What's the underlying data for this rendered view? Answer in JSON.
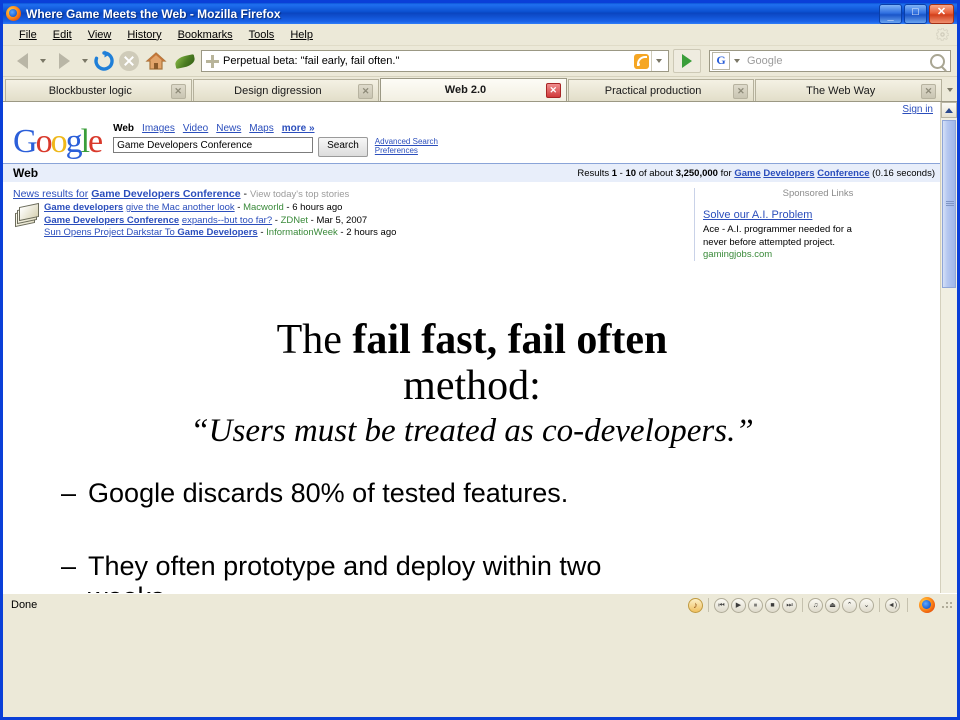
{
  "window": {
    "title": "Where Game Meets the Web - Mozilla Firefox",
    "app_icon": "firefox-icon",
    "minimize_label": "_",
    "maximize_label": "□",
    "close_label": "✕"
  },
  "menu": {
    "items": [
      "File",
      "Edit",
      "View",
      "History",
      "Bookmarks",
      "Tools",
      "Help"
    ],
    "gear_icon": "gear-icon"
  },
  "toolbar": {
    "back_icon": "back-arrow-icon",
    "forward_icon": "forward-arrow-icon",
    "reload_icon": "reload-icon",
    "stop_icon": "stop-icon",
    "home_icon": "home-icon",
    "leaf_icon": "leaf-icon",
    "url_value": "Perpetual beta: \"fail early, fail often.\"",
    "url_favicon": "page-favicon",
    "rss_icon": "rss-feed-icon",
    "go_icon": "go-arrow-icon",
    "search_engine_icon": "google-g-icon",
    "search_placeholder": "Google",
    "search_value": "",
    "search_magnifier_icon": "search-icon"
  },
  "tabs": {
    "items": [
      {
        "label": "Blockbuster logic",
        "active": false
      },
      {
        "label": "Design digression",
        "active": false
      },
      {
        "label": "Web 2.0",
        "active": true
      },
      {
        "label": "Practical production",
        "active": false
      },
      {
        "label": "The Web Way",
        "active": false
      }
    ],
    "close_label": "✕",
    "overflow_icon": "chevron-down-icon"
  },
  "google": {
    "signin_label": "Sign in",
    "logo_letters": [
      {
        "ch": "G",
        "color": "#2b5fd9"
      },
      {
        "ch": "o",
        "color": "#d9392b"
      },
      {
        "ch": "o",
        "color": "#efb81a"
      },
      {
        "ch": "g",
        "color": "#2b5fd9"
      },
      {
        "ch": "l",
        "color": "#3a9e3a"
      },
      {
        "ch": "e",
        "color": "#d9392b"
      }
    ],
    "nav_active": "Web",
    "nav_links": [
      "Images",
      "Video",
      "News",
      "Maps"
    ],
    "nav_more": "more »",
    "query": "Game Developers Conference",
    "search_button": "Search",
    "advanced_search": "Advanced Search",
    "preferences": "Preferences",
    "web_label": "Web",
    "results_prefix": "Results",
    "results_range_start": "1",
    "results_range_dash": "-",
    "results_range_end": "10",
    "results_about": "of about",
    "results_count": "3,250,000",
    "results_for": "for",
    "results_terms": [
      "Game",
      "Developers",
      "Conference"
    ],
    "results_time": "(0.16 seconds)",
    "news_heading_prefix": "News results for",
    "news_heading_query": "Game Developers Conference",
    "news_heading_dash": "-",
    "news_today_link": "View today's top stories",
    "news_icon": "news-stack-icon",
    "news_items": [
      {
        "title_plain": "Game developers",
        "title_link": "give the Mac another look",
        "source": "Macworld",
        "date": "6 hours ago",
        "bold_lead": true
      },
      {
        "title_plain": "Game Developers Conference",
        "title_link": "expands--but too far?",
        "source": "ZDNet",
        "date": "Mar 5, 2007",
        "bold_lead": true
      },
      {
        "title_plain": "Sun Opens Project Darkstar To ",
        "title_link": "Game Developers",
        "source": "InformationWeek",
        "date": "2 hours ago",
        "bold_lead": false
      }
    ],
    "sponsored_title": "Sponsored Links",
    "sponsored": {
      "title": "Solve our A.I. Problem",
      "line1": "Ace - A.I. programmer needed for a",
      "line2": "never before attempted project.",
      "url": "gamingjobs.com"
    },
    "scroll_up_icon": "scroll-up-arrow-icon"
  },
  "slide": {
    "title_part1": "The ",
    "title_bold": "fail fast, fail often",
    "title_part2": "method:",
    "quote": "“Users must be treated as co-developers.”",
    "bullets": [
      {
        "marker": "–",
        "text": "Google discards 80% of tested features."
      },
      {
        "marker": "–",
        "text": "They often prototype and deploy within two weeks."
      }
    ]
  },
  "statusbar": {
    "status": "Done",
    "media": {
      "collapse_icon": "collapse-left-icon",
      "note_icon": "music-note-icon",
      "prev_icon": "previous-track-icon",
      "play_icon": "play-icon",
      "pause_icon": "pause-icon",
      "stop_icon": "stop-icon",
      "next_icon": "next-track-icon",
      "eq_icon": "equalizer-note-icon",
      "open_icon": "eject-icon",
      "vol_up_icon": "volume-up-icon",
      "vol_down_icon": "volume-down-icon",
      "mute_icon": "speaker-icon",
      "more_icon": "overflow-arrow-icon",
      "tray_icon": "firefox-tray-icon",
      "grip_icon": "resize-grip-icon"
    }
  },
  "colors": {
    "titlebar_blue": "#0a45c0",
    "chrome": "#ece9d8",
    "link": "#2b4ebc",
    "green_url": "#3a8a3a",
    "tab_active_bg": "#fdfcf6"
  }
}
